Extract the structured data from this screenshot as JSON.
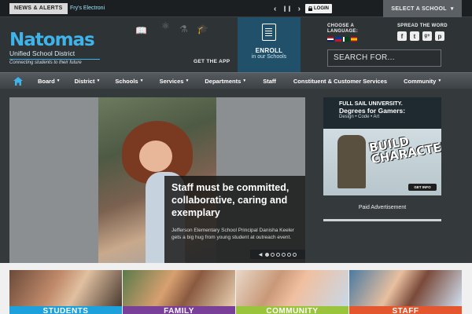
{
  "topbar": {
    "news_label": "NEWS & ALERTS",
    "ticker_text": "Fry's Electroni",
    "prev": "‹",
    "pause": "❙❙",
    "next": "›",
    "login_label": "LOGIN",
    "select_school": "SELECT A SCHOOL",
    "select_caret": "▾"
  },
  "header": {
    "logo_name": "Natomas",
    "logo_sub": "Unified School District",
    "logo_tag": "Connecting students to their future",
    "get_app": "GET THE APP",
    "enroll_title": "ENROLL",
    "enroll_sub": "in our Schools",
    "lang_title": "CHOOSE A LANGUAGE:",
    "spread_title": "SPREAD THE WORD",
    "socials": [
      "f",
      "t",
      "g+",
      "p"
    ],
    "search_placeholder": "SEARCH FOR..."
  },
  "nav": {
    "items": [
      {
        "label": "Board",
        "caret": "▼"
      },
      {
        "label": "District",
        "caret": "▼"
      },
      {
        "label": "Schools",
        "caret": "▼"
      },
      {
        "label": "Services",
        "caret": "▼"
      },
      {
        "label": "Departments",
        "caret": "▼"
      },
      {
        "label": "Staff",
        "caret": ""
      },
      {
        "label": "Constituent & Customer Services",
        "caret": ""
      },
      {
        "label": "Community",
        "caret": "▼"
      }
    ]
  },
  "slide": {
    "title": "Staff must be committed, collaborative, caring and exemplary",
    "text": "Jefferson Elementary School Principal Danisha Keeler gets a big hug from young student at outreach event."
  },
  "slider_controls": {
    "arrow": "◀",
    "active_index": 0,
    "count": 6
  },
  "ad": {
    "school": "FULL SAIL UNIVERSITY.",
    "title": "Degrees for Gamers:",
    "sub": "Design • Code • Art",
    "build": "BUILD CHARACTER",
    "cta": "GET INFO",
    "label": "Paid Advertisement"
  },
  "tiles": [
    {
      "label": "STUDENTS",
      "color": "#1da1dc"
    },
    {
      "label": "FAMILY",
      "color": "#7a3f99"
    },
    {
      "label": "COMMUNITY",
      "color": "#9ac43c"
    },
    {
      "label": "STAFF",
      "color": "#e4572e"
    }
  ],
  "colors": {
    "brand_blue": "#3fb4ea",
    "enroll_bg": "#21506a",
    "home_icon": "#3fb4ea"
  }
}
